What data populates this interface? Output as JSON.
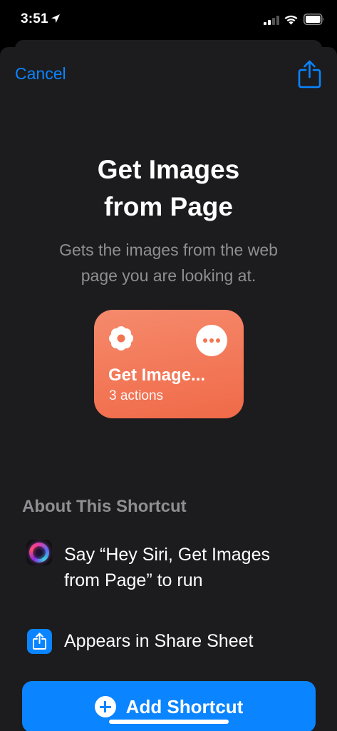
{
  "status_bar": {
    "time": "3:51"
  },
  "nav": {
    "cancel_label": "Cancel"
  },
  "shortcut": {
    "title_line1": "Get Images",
    "title_line2": "from Page",
    "description_line1": "Gets the images from the web",
    "description_line2": "page you are looking at.",
    "card_title": "Get Image...",
    "card_subtitle": "3 actions",
    "card_color": "#f27552"
  },
  "about": {
    "header": "About This Shortcut",
    "items": [
      {
        "icon": "siri-icon",
        "line1": "Say “Hey Siri, Get Images",
        "line2": "from Page” to run"
      },
      {
        "icon": "share-sheet-icon",
        "line1": "Appears in Share Sheet"
      }
    ]
  },
  "actions": {
    "add_label": "Add Shortcut"
  },
  "colors": {
    "accent": "#0a84ff",
    "sheet_background": "#1c1c1e",
    "secondary_text": "#8e8e93"
  }
}
